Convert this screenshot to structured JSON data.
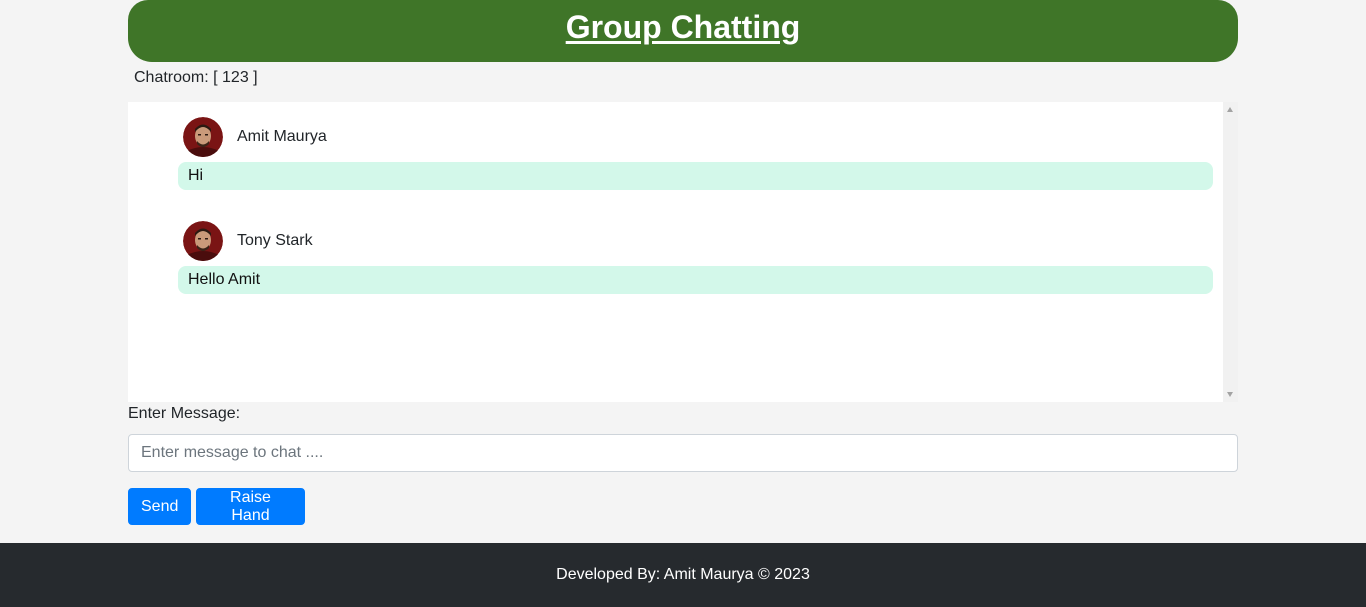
{
  "header": {
    "title": "Group Chatting",
    "color": "#3f7528"
  },
  "chatroom": {
    "label": "Chatroom: [ 123 ]"
  },
  "messages": [
    {
      "sender": "Amit Maurya",
      "text": "Hi",
      "avatar_icon": "user-avatar-icon"
    },
    {
      "sender": "Tony Stark",
      "text": "Hello Amit",
      "avatar_icon": "user-avatar-icon"
    }
  ],
  "bubble_color": "#d3f8ea",
  "input": {
    "label": "Enter Message:",
    "value": "",
    "placeholder": "Enter message to chat ...."
  },
  "buttons": {
    "send_label": "Send",
    "raise_hand_label": "Raise Hand",
    "color": "#007bff"
  },
  "footer": {
    "text": "Developed By: Amit Maurya © 2023",
    "color": "#262a2e"
  }
}
